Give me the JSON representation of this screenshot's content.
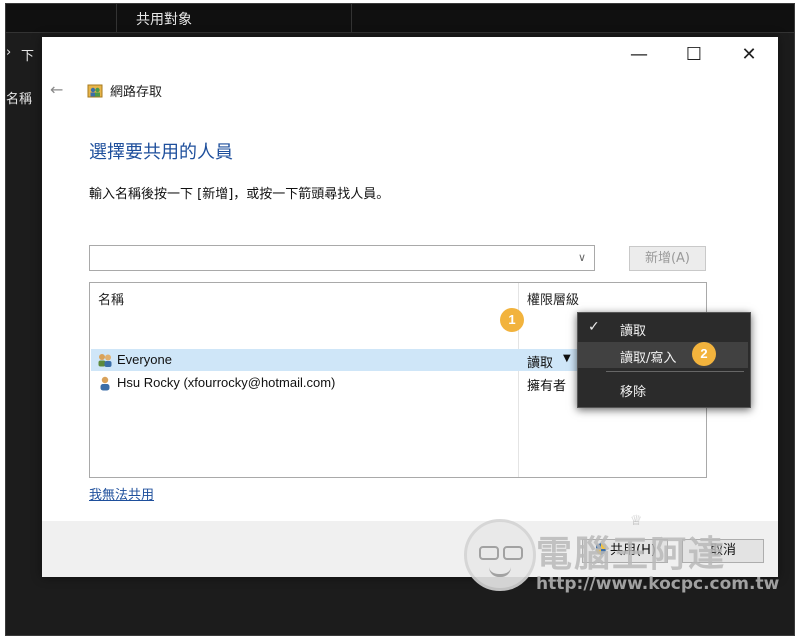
{
  "explorer": {
    "title": "共用對象",
    "nav_text": "下",
    "column_label": "名稱",
    "nav_arrow": "›"
  },
  "dialog": {
    "nav_title": "網路存取",
    "heading": "選擇要共用的人員",
    "instruction": "輸入名稱後按一下 [新增]，或按一下箭頭尋找人員。",
    "input_value": "",
    "add_button": "新增(A)",
    "list": {
      "col_name": "名稱",
      "col_permission": "權限層級",
      "rows": [
        {
          "name": "Everyone",
          "permission": "讀取",
          "icon": "group-icon",
          "selected": true
        },
        {
          "name": "Hsu Rocky (xfourrocky@hotmail.com)",
          "permission": "擁有者",
          "icon": "user-icon",
          "selected": false
        }
      ]
    },
    "trouble_link": "我無法共用",
    "share_button": "共用(H)",
    "cancel_button": "取消",
    "window_controls": {
      "minimize": "—",
      "maximize": "☐",
      "close": "✕"
    }
  },
  "menu": {
    "items": [
      {
        "label": "讀取",
        "checked": true
      },
      {
        "label": "讀取/寫入",
        "checked": false
      },
      {
        "label": "移除",
        "checked": false
      }
    ]
  },
  "annotations": {
    "step1": "1",
    "step2": "2"
  },
  "watermark": {
    "title": "電腦王阿達",
    "url": "http://www.kocpc.com.tw"
  },
  "colors": {
    "accent": "#1e4f9c",
    "badge": "#f2b33d",
    "selection": "#cfe6f8",
    "menu_bg": "#2b2b2b"
  }
}
